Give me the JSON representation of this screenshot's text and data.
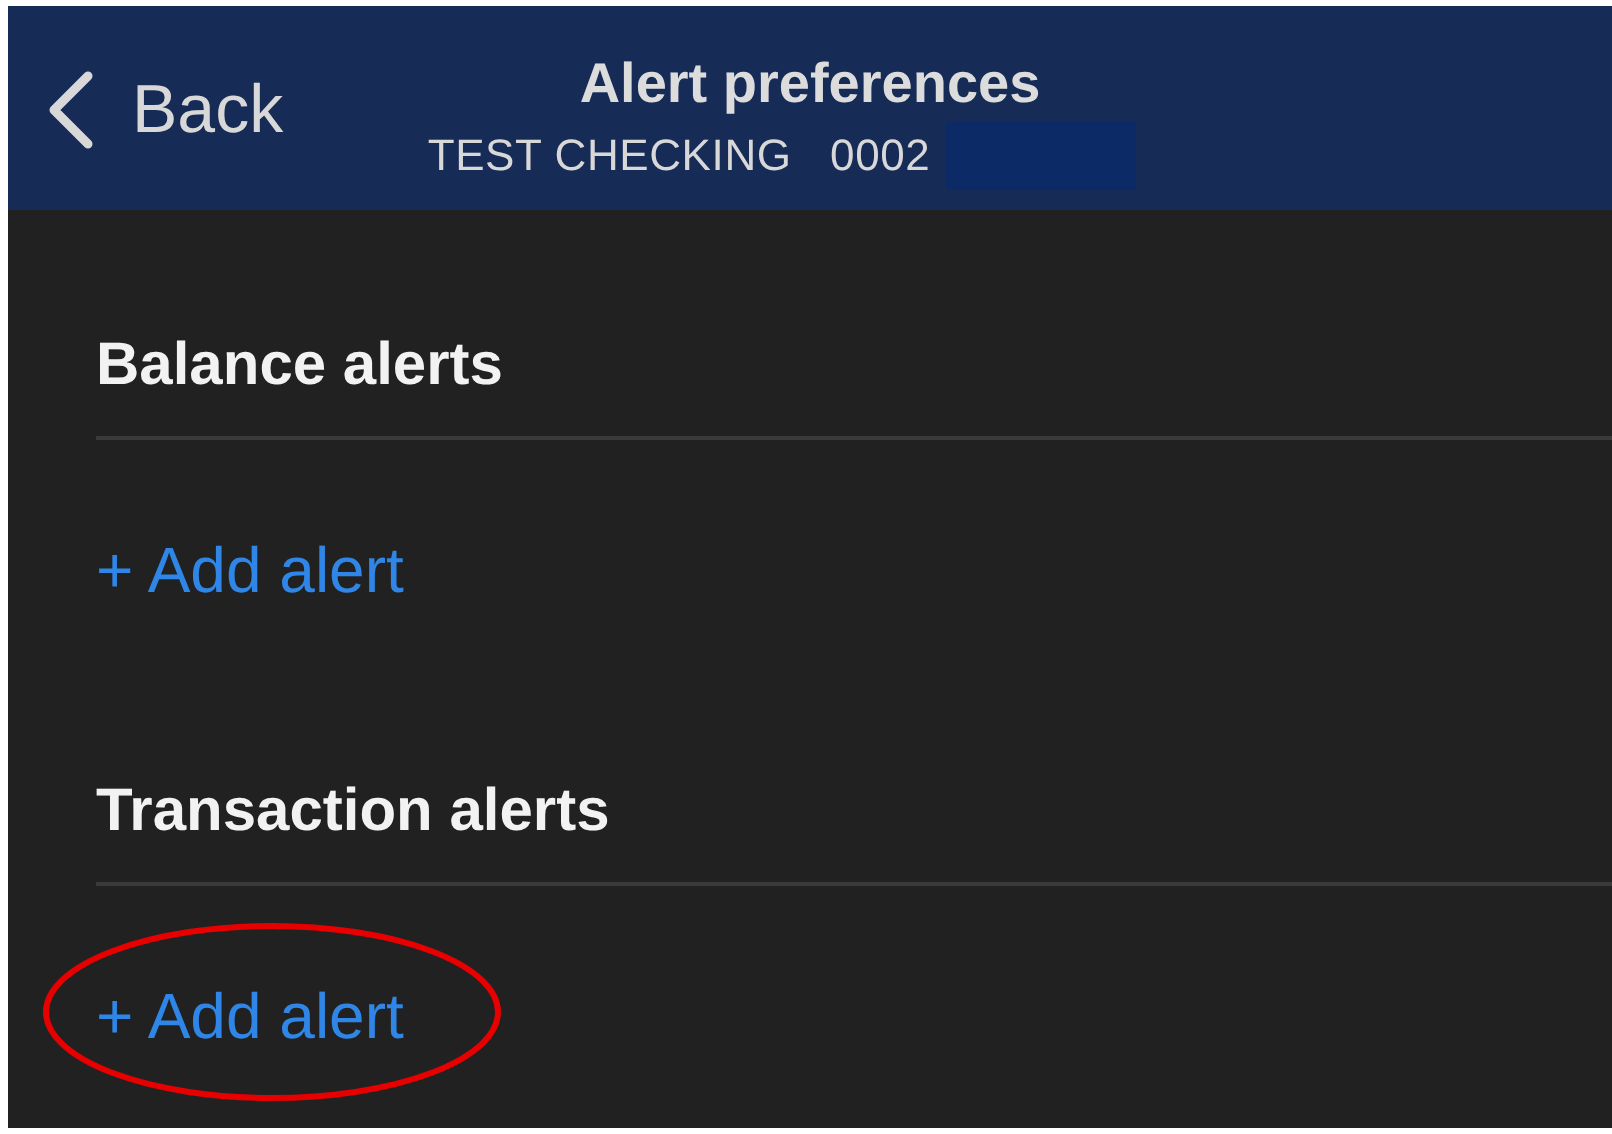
{
  "header": {
    "back_label": "Back",
    "title": "Alert preferences",
    "subtitle": "TEST CHECKING   0002",
    "subtitle_redacted": true
  },
  "sections": [
    {
      "title": "Balance alerts",
      "action": "+ Add alert",
      "highlighted": false
    },
    {
      "title": "Transaction alerts",
      "action": "+ Add alert",
      "highlighted": true
    }
  ]
}
